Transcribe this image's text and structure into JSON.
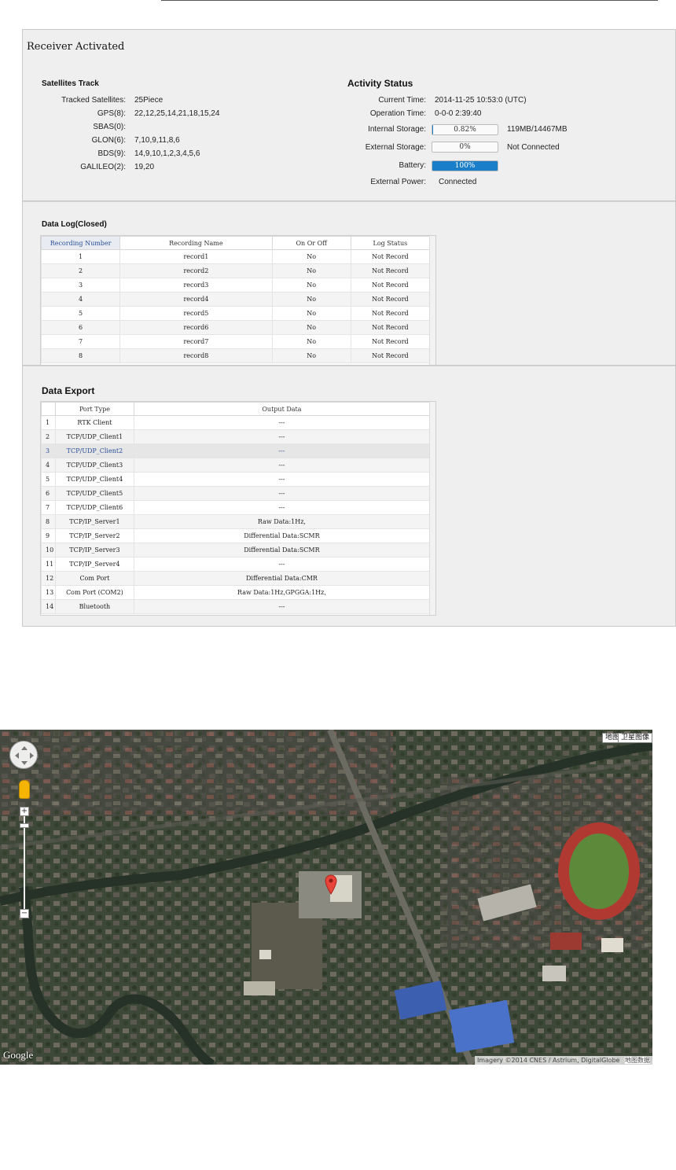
{
  "panel": {
    "title": "Receiver Activated"
  },
  "satellites": {
    "title": "Satellites Track",
    "rows": [
      {
        "key": "Tracked Satellites:",
        "value": "25Piece"
      },
      {
        "key": "GPS(8):",
        "value": "22,12,25,14,21,18,15,24"
      },
      {
        "key": "SBAS(0):",
        "value": ""
      },
      {
        "key": "GLON(6):",
        "value": "7,10,9,11,8,6"
      },
      {
        "key": "BDS(9):",
        "value": "14,9,10,1,2,3,4,5,6"
      },
      {
        "key": "GALILEO(2):",
        "value": "19,20"
      }
    ]
  },
  "activity": {
    "title": "Activity Status",
    "current_time_label": "Current Time:",
    "current_time": "2014-11-25 10:53:0 (UTC)",
    "operation_time_label": "Operation Time:",
    "operation_time": "0-0-0 2:39:40",
    "internal_storage_label": "Internal Storage:",
    "internal_storage_pct_text": "0.82%",
    "internal_storage_fraction": 0.0082,
    "internal_storage_detail": "119MB/14467MB",
    "external_storage_label": "External Storage:",
    "external_storage_pct_text": "0%",
    "external_storage_fraction": 0,
    "external_storage_detail": "Not Connected",
    "battery_label": "Battery:",
    "battery_pct_text": "100%",
    "battery_fraction": 1,
    "external_power_label": "External Power:",
    "external_power": "Connected",
    "accent_color": "#1a7fc8"
  },
  "datalog": {
    "title": "Data Log(Closed)",
    "columns": [
      "Recording Number",
      "Recording Name",
      "On Or Off",
      "Log Status"
    ],
    "rows": [
      [
        "1",
        "record1",
        "No",
        "Not Record"
      ],
      [
        "2",
        "record2",
        "No",
        "Not Record"
      ],
      [
        "3",
        "record3",
        "No",
        "Not Record"
      ],
      [
        "4",
        "record4",
        "No",
        "Not Record"
      ],
      [
        "5",
        "record5",
        "No",
        "Not Record"
      ],
      [
        "6",
        "record6",
        "No",
        "Not Record"
      ],
      [
        "7",
        "record7",
        "No",
        "Not Record"
      ],
      [
        "8",
        "record8",
        "No",
        "Not Record"
      ]
    ]
  },
  "export": {
    "title": "Data Export",
    "columns": [
      "",
      "Port Type",
      "Output Data"
    ],
    "rows": [
      [
        "1",
        "RTK Client",
        "---"
      ],
      [
        "2",
        "TCP/UDP_Client1",
        "---"
      ],
      [
        "3",
        "TCP/UDP_Client2",
        "---"
      ],
      [
        "4",
        "TCP/UDP_Client3",
        "---"
      ],
      [
        "5",
        "TCP/UDP_Client4",
        "---"
      ],
      [
        "6",
        "TCP/UDP_Client5",
        "---"
      ],
      [
        "7",
        "TCP/UDP_Client6",
        "---"
      ],
      [
        "8",
        "TCP/IP_Server1",
        "Raw Data:1Hz,"
      ],
      [
        "9",
        "TCP/IP_Server2",
        "Differential Data:SCMR"
      ],
      [
        "10",
        "TCP/IP_Server3",
        "Differential Data:SCMR"
      ],
      [
        "11",
        "TCP/IP_Server4",
        "---"
      ],
      [
        "12",
        "Com Port",
        "Differential Data:CMR"
      ],
      [
        "13",
        "Com Port (COM2)",
        "Raw Data:1Hz,GPGGA:1Hz,"
      ],
      [
        "14",
        "Bluetooth",
        "---"
      ]
    ],
    "selected_row": 2
  },
  "map": {
    "map_button": "地图",
    "satellite_button": "卫星图像",
    "logo": "Google",
    "attribution": "Imagery ©2014 CNES / Astrium, DigitalGlobe",
    "attribution_extra": "地图数据"
  }
}
